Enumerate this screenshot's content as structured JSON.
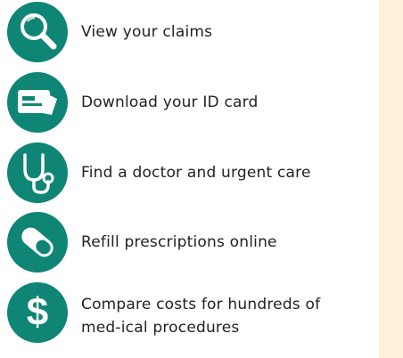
{
  "features": [
    {
      "label": "View your claims",
      "icon": "magnifier-icon"
    },
    {
      "label": "Download your ID card",
      "icon": "id-card-icon"
    },
    {
      "label": "Find a doctor and urgent care",
      "icon": "stethoscope-icon"
    },
    {
      "label": "Refill prescriptions online",
      "icon": "pill-capsule-icon"
    },
    {
      "label": "Compare costs for hundreds of med-ical procedures",
      "icon": "dollar-sign-icon"
    }
  ],
  "colors": {
    "icon_background": "#0f8576",
    "side_panel": "#fdf1dc",
    "text": "#222222"
  }
}
